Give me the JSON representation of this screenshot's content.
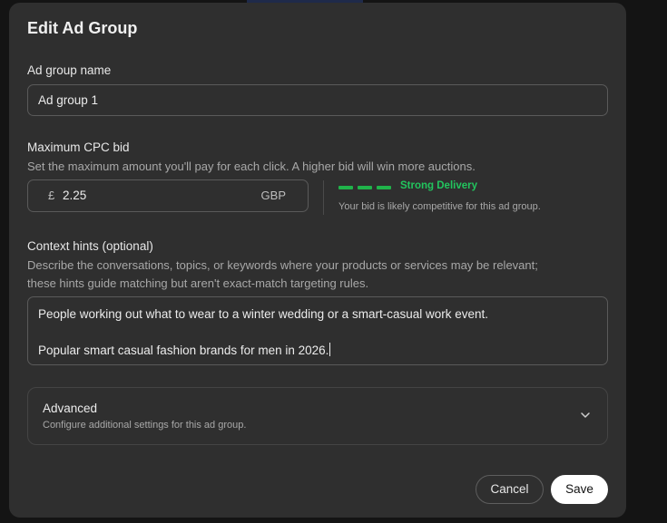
{
  "modal": {
    "title": "Edit Ad Group"
  },
  "ad_group_name": {
    "label": "Ad group name",
    "value": "Ad group 1"
  },
  "max_cpc": {
    "label": "Maximum CPC bid",
    "help": "Set the maximum amount you'll pay for each click. A higher bid will win more auctions.",
    "currency_symbol": "£",
    "amount": "2.25",
    "currency_code": "GBP",
    "delivery_status": "Strong Delivery",
    "delivery_note": "Your bid is likely competitive for this ad group.",
    "delivery_color": "#22c55e",
    "delivery_level": "3 of 3"
  },
  "context_hints": {
    "label": "Context hints (optional)",
    "help_line1": "Describe the conversations, topics, or keywords where your products or services may be relevant;",
    "help_line2": "these hints guide matching but aren't exact-match targeting rules.",
    "line1": "People working out what to wear to a winter wedding or a smart-casual work event.",
    "line2": "Popular smart casual fashion brands for men in 2026."
  },
  "advanced": {
    "title": "Advanced",
    "description": "Configure additional settings for this ad group.",
    "icon": "chevron-down-icon"
  },
  "actions": {
    "cancel_label": "Cancel",
    "save_label": "Save"
  }
}
